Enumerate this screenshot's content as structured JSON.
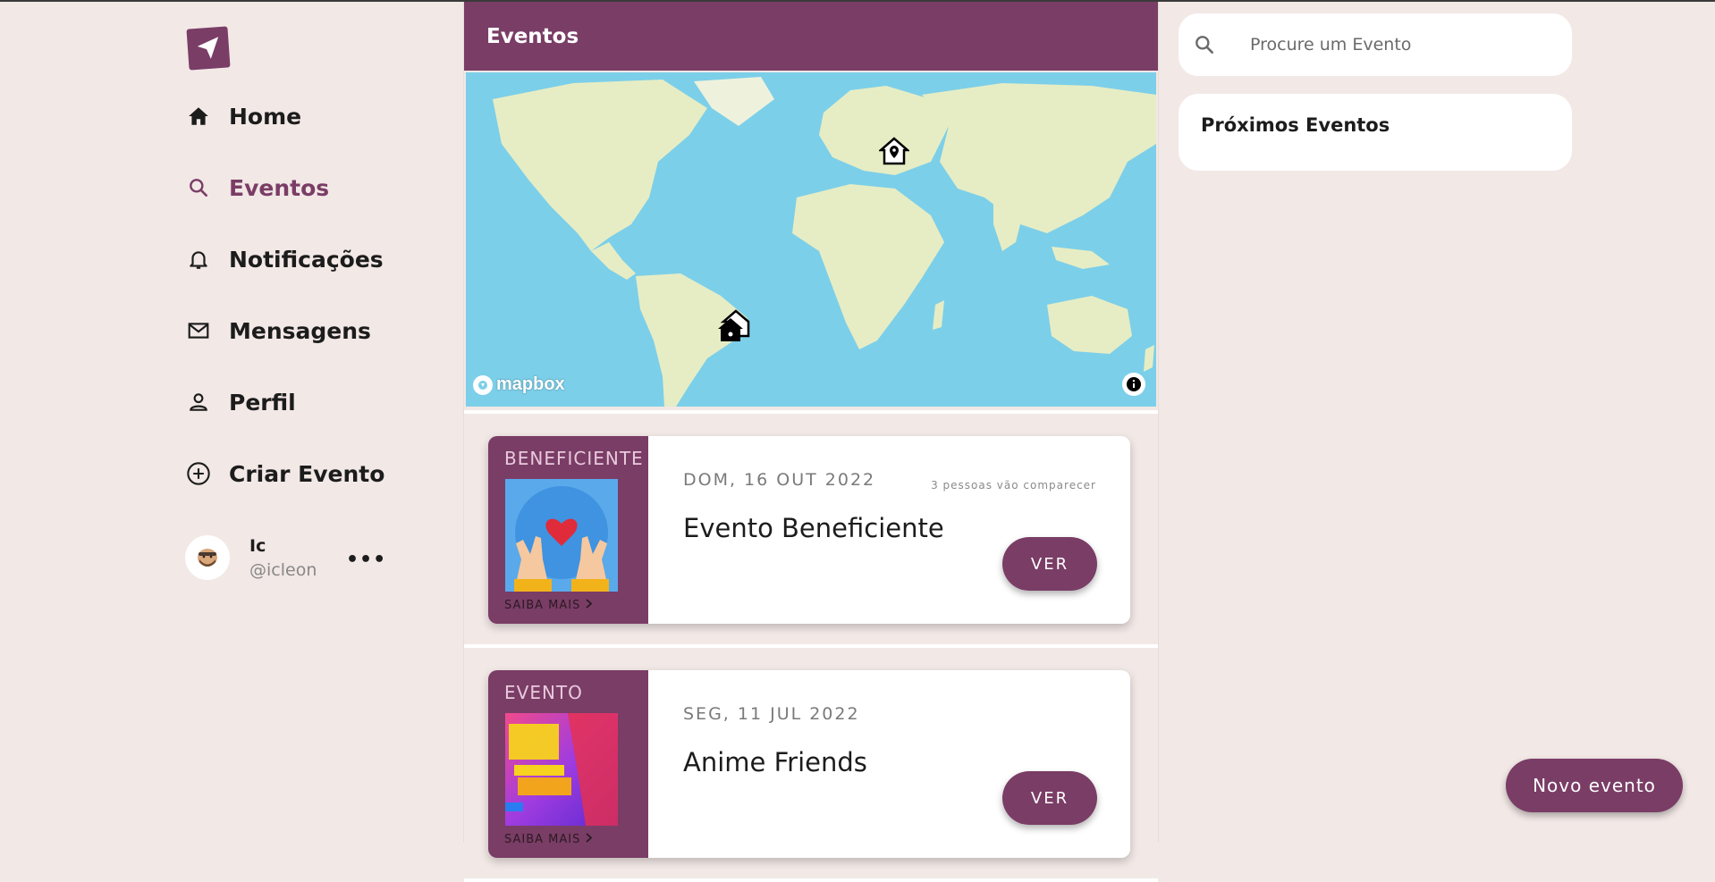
{
  "nav": {
    "items": [
      {
        "label": "Home",
        "icon": "home-icon"
      },
      {
        "label": "Eventos",
        "icon": "search-icon",
        "active": true
      },
      {
        "label": "Notificações",
        "icon": "bell-icon"
      },
      {
        "label": "Mensagens",
        "icon": "mail-icon"
      },
      {
        "label": "Perfil",
        "icon": "person-icon"
      },
      {
        "label": "Criar Evento",
        "icon": "add-circle-icon"
      }
    ],
    "user": {
      "name": "Ic",
      "handle": "@icleon",
      "more": "•••"
    }
  },
  "header": {
    "title": "Eventos"
  },
  "map": {
    "attribution": "mapbox"
  },
  "events": [
    {
      "category": "BENEFICIENTE",
      "date": "DOM, 16 OUT 2022",
      "attendees": "3 pessoas vão comparecer",
      "title": "Evento Beneficiente",
      "more": "SAIBA MAIS",
      "button": "VER"
    },
    {
      "category": "EVENTO",
      "date": "SEG, 11 JUL 2022",
      "attendees": "",
      "title": "Anime Friends",
      "more": "SAIBA MAIS",
      "button": "VER"
    }
  ],
  "search": {
    "placeholder": "Procure um Evento"
  },
  "upcoming": {
    "title": "Próximos Eventos"
  },
  "fab": {
    "label": "Novo evento"
  },
  "colors": {
    "primary": "#7a3d66",
    "background": "#f2e8e6",
    "water": "#7ccfe9",
    "land": "#e6edc4"
  }
}
